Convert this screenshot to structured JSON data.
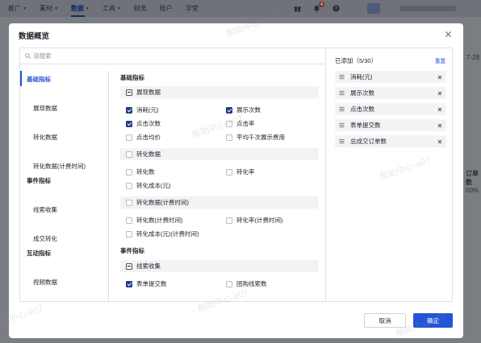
{
  "topbar": {
    "nav": [
      {
        "label": "推广",
        "caret": true,
        "active": false
      },
      {
        "label": "素材",
        "caret": true,
        "active": false
      },
      {
        "label": "数据",
        "caret": true,
        "active": true
      },
      {
        "label": "工具",
        "caret": true,
        "active": false
      },
      {
        "label": "财务",
        "caret": false,
        "active": false
      },
      {
        "label": "账户",
        "caret": false,
        "active": false
      },
      {
        "label": "学堂",
        "caret": false,
        "active": false
      }
    ],
    "notification_count": "4",
    "icons": [
      "gift-icon",
      "bell-icon",
      "help-icon"
    ]
  },
  "background": {
    "snip_date": "7-28",
    "snip_metric": "订单数",
    "snip_percent": "00%"
  },
  "modal": {
    "title": "数据概览",
    "search_placeholder": "请搜索",
    "added_title": "已添加（5/30）",
    "reset_label": "重置",
    "cancel_label": "取消",
    "ok_label": "确定"
  },
  "watermark": "帮助中心-e07",
  "leftnav": [
    {
      "label": "基础指标",
      "type": "group",
      "active": true
    },
    {
      "label": "展现数据",
      "type": "item",
      "active": false
    },
    {
      "label": "转化数据",
      "type": "item",
      "active": false
    },
    {
      "label": "转化数据(计费时间)",
      "type": "item",
      "active": false
    },
    {
      "label": "事件指标",
      "type": "group",
      "active": false
    },
    {
      "label": "线索收集",
      "type": "item",
      "active": false
    },
    {
      "label": "成交转化",
      "type": "item",
      "active": false
    },
    {
      "label": "互动指标",
      "type": "group",
      "active": false
    },
    {
      "label": "视频数据",
      "type": "item",
      "active": false
    }
  ],
  "content": {
    "section1": "基础指标",
    "group_display": {
      "label": "展现数据",
      "state": "partial"
    },
    "display_options": [
      {
        "label": "消耗(元)",
        "checked": true
      },
      {
        "label": "展示次数",
        "checked": true
      },
      {
        "label": "点击次数",
        "checked": true
      },
      {
        "label": "点击率",
        "checked": false
      },
      {
        "label": "点击均价",
        "checked": false
      },
      {
        "label": "平均千次展示费用",
        "checked": false
      }
    ],
    "group_conversion": {
      "label": "转化数据",
      "state": "none"
    },
    "conversion_options": [
      {
        "label": "转化数",
        "checked": false
      },
      {
        "label": "转化率",
        "checked": false
      },
      {
        "label": "转化成本(元)",
        "checked": false
      }
    ],
    "group_conversion_billing": {
      "label": "转化数据(计费时间)",
      "state": "none"
    },
    "conversion_billing_options": [
      {
        "label": "转化数(计费时间)",
        "checked": false
      },
      {
        "label": "转化率(计费时间)",
        "checked": false
      },
      {
        "label": "转化成本(元)(计费时间)",
        "checked": false
      }
    ],
    "section2": "事件指标",
    "group_leads": {
      "label": "线索收集",
      "state": "partial"
    },
    "leads_options": [
      {
        "label": "表单提交数",
        "checked": true
      },
      {
        "label": "团购线索数",
        "checked": false
      }
    ]
  },
  "added": [
    {
      "label": "消耗(元)"
    },
    {
      "label": "展示次数"
    },
    {
      "label": "点击次数"
    },
    {
      "label": "表单提交数"
    },
    {
      "label": "总成交订单数"
    }
  ]
}
